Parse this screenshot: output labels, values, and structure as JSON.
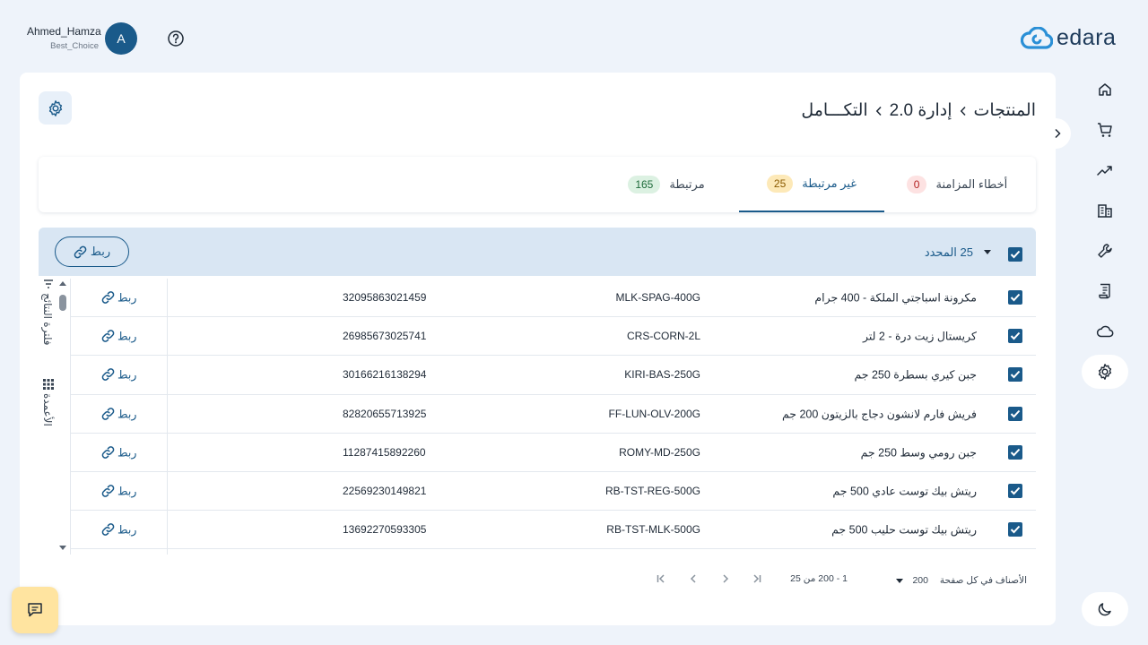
{
  "user": {
    "name": "Ahmed_Hamza",
    "company": "Best_Choice",
    "avatar_letter": "A"
  },
  "logo": {
    "text": "edara"
  },
  "breadcrumb": {
    "items": [
      "التكـــامل",
      "إدارة 2.0",
      "المنتجات"
    ]
  },
  "tabs": [
    {
      "label": "أخطاء المزامنة",
      "count": "0",
      "badge_bg": "#fde2e2",
      "badge_color": "#b42323"
    },
    {
      "label": "غير مرتبطة",
      "count": "25",
      "badge_bg": "#fde9b8",
      "badge_color": "#8a5a00"
    },
    {
      "label": "مرتبطة",
      "count": "165",
      "badge_bg": "#dcf1e2",
      "badge_color": "#1e6b3a"
    }
  ],
  "toolbar": {
    "selected_label": "25 المحدد",
    "link_label": "ربط"
  },
  "side": {
    "filter_label": "فلترة النتائج",
    "columns_label": "الأعمدة"
  },
  "rows": [
    {
      "name": "مكرونة اسباجتي الملكة - 400 جرام",
      "sku": "MLK-SPAG-400G",
      "barcode": "32095863021459",
      "action": "ربط"
    },
    {
      "name": "كريستال زيت درة - 2 لتر",
      "sku": "CRS-CORN-2L",
      "barcode": "26985673025741",
      "action": "ربط"
    },
    {
      "name": "جبن كيري بسطرة 250 جم",
      "sku": "KIRI-BAS-250G",
      "barcode": "30166216138294",
      "action": "ربط"
    },
    {
      "name": "فريش فارم لانشون دجاج بالزيتون 200 جم",
      "sku": "FF-LUN-OLV-200G",
      "barcode": "82820655713925",
      "action": "ربط"
    },
    {
      "name": "جبن رومي وسط 250 جم",
      "sku": "ROMY-MD-250G",
      "barcode": "11287415892260",
      "action": "ربط"
    },
    {
      "name": "ريتش بيك توست عادي 500 جم",
      "sku": "RB-TST-REG-500G",
      "barcode": "22569230149821",
      "action": "ربط"
    },
    {
      "name": "ريتش بيك توست حليب 500 جم",
      "sku": "RB-TST-MLK-500G",
      "barcode": "13692270593305",
      "action": "ربط"
    }
  ],
  "pagination": {
    "per_page_label": "الأصناف في كل صفحة",
    "page_size": "200",
    "range": "1 - 200 من 25"
  },
  "colors": {
    "primary": "#1a5a8a",
    "toolbar_bg": "#d9e6f3",
    "page_bg": "#eef3fa"
  }
}
